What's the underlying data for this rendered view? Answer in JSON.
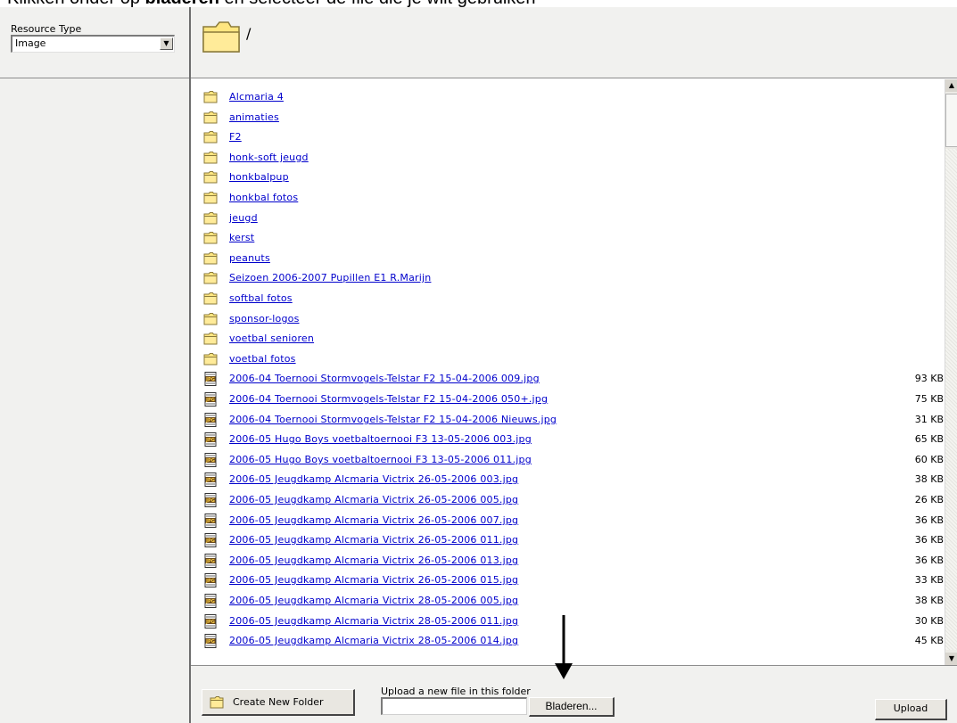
{
  "caption": {
    "part1": "Klikken onder op ",
    "bold": "bladeren",
    "part2": " en selecteer de file die je wilt gebruiken"
  },
  "sidebar": {
    "resource_type_label": "Resource Type",
    "resource_type_value": "Image"
  },
  "path_bar": {
    "current_path": "/"
  },
  "folders": [
    {
      "name": "Alcmaria 4"
    },
    {
      "name": "animaties"
    },
    {
      "name": "F2"
    },
    {
      "name": "honk-soft jeugd"
    },
    {
      "name": "honkbalpup"
    },
    {
      "name": "honkbal fotos"
    },
    {
      "name": "jeugd"
    },
    {
      "name": "kerst"
    },
    {
      "name": "peanuts"
    },
    {
      "name": "Seizoen 2006-2007 Pupillen E1 R.Marijn"
    },
    {
      "name": "softbal fotos"
    },
    {
      "name": "sponsor-logos"
    },
    {
      "name": "voetbal senioren"
    },
    {
      "name": "voetbal fotos"
    }
  ],
  "files": [
    {
      "name": "2006-04 Toernooi Stormvogels-Telstar F2 15-04-2006 009.jpg",
      "size": "93 KB"
    },
    {
      "name": "2006-04 Toernooi Stormvogels-Telstar F2 15-04-2006 050+.jpg",
      "size": "75 KB"
    },
    {
      "name": "2006-04 Toernooi Stormvogels-Telstar F2 15-04-2006 Nieuws.jpg",
      "size": "31 KB"
    },
    {
      "name": "2006-05 Hugo Boys voetbaltoernooi F3 13-05-2006 003.jpg",
      "size": "65 KB"
    },
    {
      "name": "2006-05 Hugo Boys voetbaltoernooi F3 13-05-2006 011.jpg",
      "size": "60 KB"
    },
    {
      "name": "2006-05 Jeugdkamp Alcmaria Victrix 26-05-2006 003.jpg",
      "size": "38 KB"
    },
    {
      "name": "2006-05 Jeugdkamp Alcmaria Victrix 26-05-2006 005.jpg",
      "size": "26 KB"
    },
    {
      "name": "2006-05 Jeugdkamp Alcmaria Victrix 26-05-2006 007.jpg",
      "size": "36 KB"
    },
    {
      "name": "2006-05 Jeugdkamp Alcmaria Victrix 26-05-2006 011.jpg",
      "size": "36 KB"
    },
    {
      "name": "2006-05 Jeugdkamp Alcmaria Victrix 26-05-2006 013.jpg",
      "size": "36 KB"
    },
    {
      "name": "2006-05 Jeugdkamp Alcmaria Victrix 26-05-2006 015.jpg",
      "size": "33 KB"
    },
    {
      "name": "2006-05 Jeugdkamp Alcmaria Victrix 28-05-2006 005.jpg",
      "size": "38 KB"
    },
    {
      "name": "2006-05 Jeugdkamp Alcmaria Victrix 28-05-2006 011.jpg",
      "size": "30 KB"
    },
    {
      "name": "2006-05 Jeugdkamp Alcmaria Victrix 28-05-2006 014.jpg",
      "size": "45 KB"
    }
  ],
  "bottom": {
    "create_folder_label": "Create New Folder",
    "upload_label": "Upload a new file in this folder",
    "browse_label": "Bladeren...",
    "upload_button": "Upload"
  },
  "icons": {
    "folder": "folder-icon",
    "file": "jpg-file-icon",
    "dropdown": "chevron-down-icon"
  },
  "colors": {
    "link": "#0000cc",
    "panel": "#f1f1ef",
    "folder_fill": "#ffe680",
    "folder_stroke": "#8a7a3a"
  }
}
